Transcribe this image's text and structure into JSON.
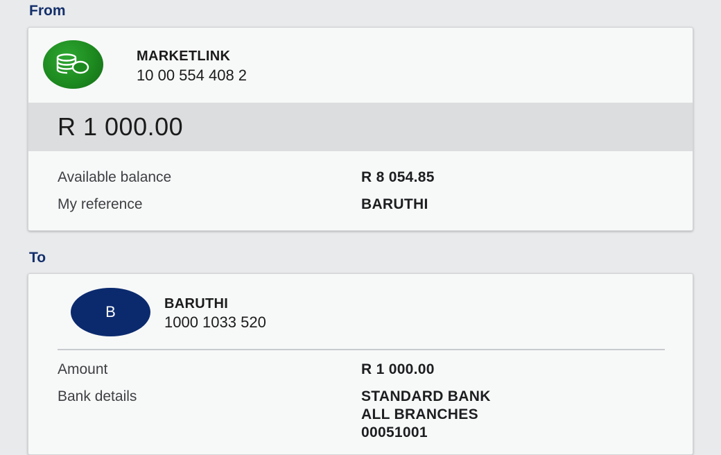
{
  "from": {
    "section_label": "From",
    "account": {
      "icon": "coins-icon",
      "icon_color": "#1d8a1f",
      "name": "MARKETLINK",
      "number": "10 00 554 408 2"
    },
    "amount": "R 1 000.00",
    "details": [
      {
        "label": "Available balance",
        "value": "R 8 054.85"
      },
      {
        "label": "My reference",
        "value": "BARUTHI"
      }
    ]
  },
  "to": {
    "section_label": "To",
    "beneficiary": {
      "avatar_letter": "B",
      "avatar_color": "#0b2a6e",
      "name": "BARUTHI",
      "number": "1000 1033 520"
    },
    "details": {
      "amount_label": "Amount",
      "amount_value": "R 1 000.00",
      "bank_label": "Bank details",
      "bank_lines": [
        "STANDARD BANK",
        "ALL BRANCHES",
        "00051001"
      ]
    }
  }
}
